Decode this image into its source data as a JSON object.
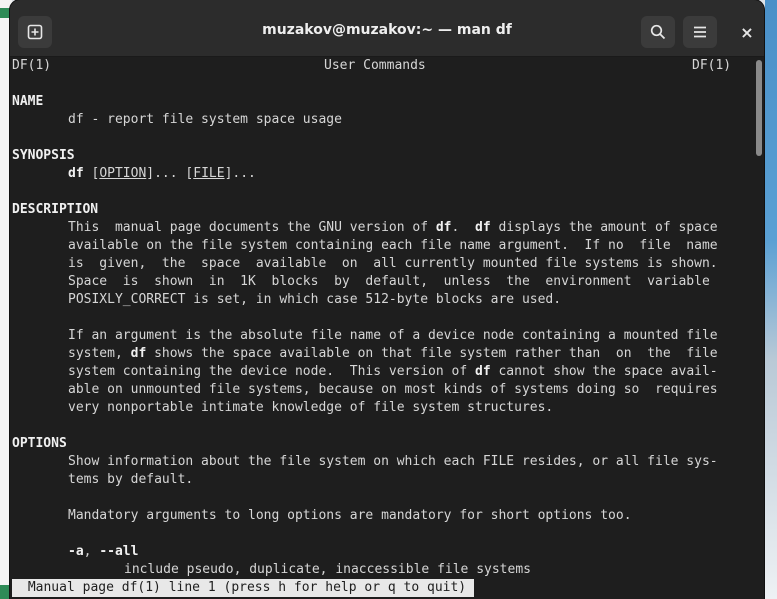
{
  "window": {
    "title": "muzakov@muzakov:~ — man df",
    "close_glyph": "×"
  },
  "icons": {
    "new_tab": "new-tab-icon",
    "search": "search-icon",
    "menu": "hamburger-menu-icon",
    "close": "close-icon"
  },
  "man": {
    "header_left": "DF(1)",
    "header_center": "User Commands",
    "header_right": "DF(1)",
    "name_heading": "NAME",
    "name_text": "df - report file system space usage",
    "synopsis_heading": "SYNOPSIS",
    "synopsis_cmd": "df",
    "synopsis_option": "OPTION",
    "synopsis_sep": "]... [",
    "synopsis_file": "FILE",
    "synopsis_tail": "]...",
    "description_heading": "DESCRIPTION",
    "d1_a": "This  manual page documents the GNU version of ",
    "d1_df1": "df",
    "d1_b": ".  ",
    "d1_df2": "df",
    "d1_c": " displays the amount of space",
    "d2": "available on the file system containing each file name argument.  If no  file  name",
    "d3": "is  given,  the  space  available  on  all currently mounted file systems is shown.",
    "d4": "Space  is  shown  in  1K  blocks  by  default,  unless  the  environment  variable",
    "d5": "POSIXLY_CORRECT is set, in which case 512-byte blocks are used.",
    "p2_1": "If an argument is the absolute file name of a device node containing a mounted file",
    "p2_2a": "system, ",
    "p2_2df": "df",
    "p2_2b": " shows the space available on that file system rather than  on  the  file",
    "p2_3a": "system containing the device node.  This version of ",
    "p2_3df": "df",
    "p2_3b": " cannot show the space avail-",
    "p2_4": "able on unmounted file systems, because on most kinds of systems doing so  requires",
    "p2_5": "very nonportable intimate knowledge of file system structures.",
    "options_heading": "OPTIONS",
    "o1": "Show information about the file system on which each FILE resides, or all file sys-",
    "o2": "tems by default.",
    "o3": "Mandatory arguments to long options are mandatory for short options too.",
    "opt_a_short": "-a",
    "opt_a_comma": ", ",
    "opt_a_long": "--all",
    "opt_a_desc": "include pseudo, duplicate, inaccessible file systems"
  },
  "status_bar": " Manual page df(1) line 1 (press h for help or q to quit)"
}
